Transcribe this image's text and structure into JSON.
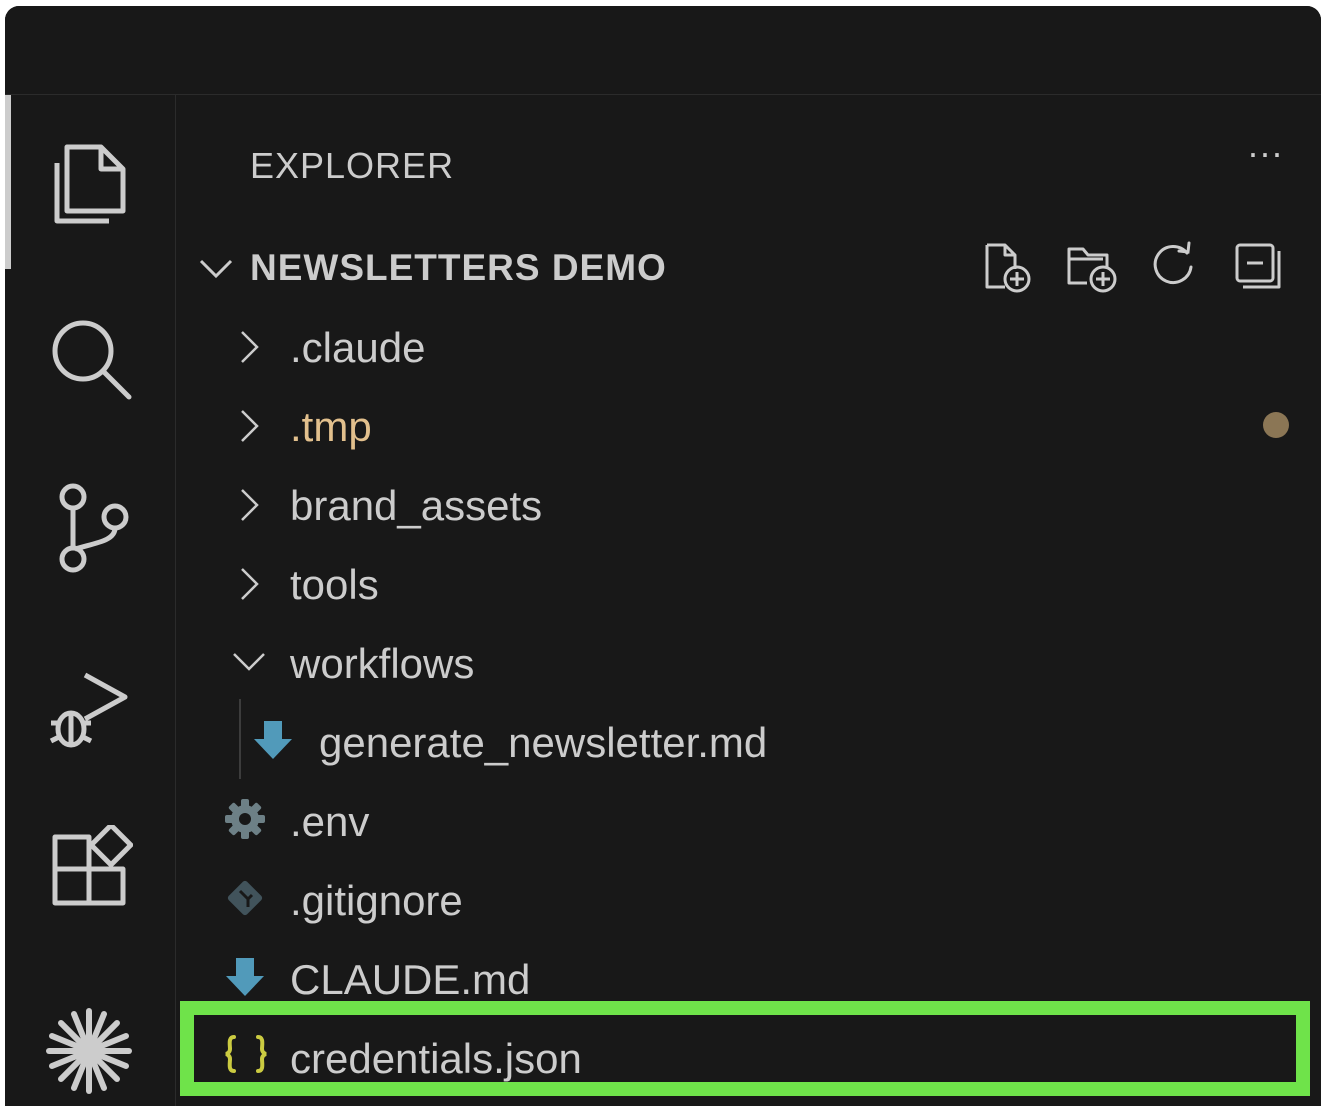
{
  "colors": {
    "background": "#181818",
    "text": "#cccccc",
    "ignored_text": "#e2c08d",
    "highlight_border": "#6fe34a",
    "markdown_icon": "#519aba",
    "json_icon": "#cbcb41",
    "modified_dot": "#8b7655"
  },
  "activity_bar": {
    "items": [
      {
        "name": "explorer",
        "icon": "files-icon",
        "active": true
      },
      {
        "name": "search",
        "icon": "search-icon"
      },
      {
        "name": "source-control",
        "icon": "source-control-icon"
      },
      {
        "name": "run-and-debug",
        "icon": "debug-icon"
      },
      {
        "name": "extensions",
        "icon": "extensions-icon"
      },
      {
        "name": "claude",
        "icon": "claude-sparkle-icon"
      }
    ]
  },
  "sidebar": {
    "title": "EXPLORER",
    "more_label": "···",
    "section": {
      "title": "NEWSLETTERS DEMO",
      "actions": [
        "new-file-icon",
        "new-folder-icon",
        "refresh-icon",
        "collapse-all-icon"
      ]
    },
    "tree": [
      {
        "label": ".claude",
        "type": "folder",
        "expanded": false
      },
      {
        "label": ".tmp",
        "type": "folder",
        "expanded": false,
        "ignored": true,
        "modified_dot": true
      },
      {
        "label": "brand_assets",
        "type": "folder",
        "expanded": false
      },
      {
        "label": "tools",
        "type": "folder",
        "expanded": false
      },
      {
        "label": "workflows",
        "type": "folder",
        "expanded": true
      },
      {
        "label": "generate_newsletter.md",
        "type": "file",
        "icon": "markdown-icon",
        "depth": 1
      },
      {
        "label": ".env",
        "type": "file",
        "icon": "gear-icon"
      },
      {
        "label": ".gitignore",
        "type": "file",
        "icon": "git-icon"
      },
      {
        "label": "CLAUDE.md",
        "type": "file",
        "icon": "markdown-icon"
      },
      {
        "label": "credentials.json",
        "type": "file",
        "icon": "json-icon",
        "highlighted": true
      }
    ]
  }
}
